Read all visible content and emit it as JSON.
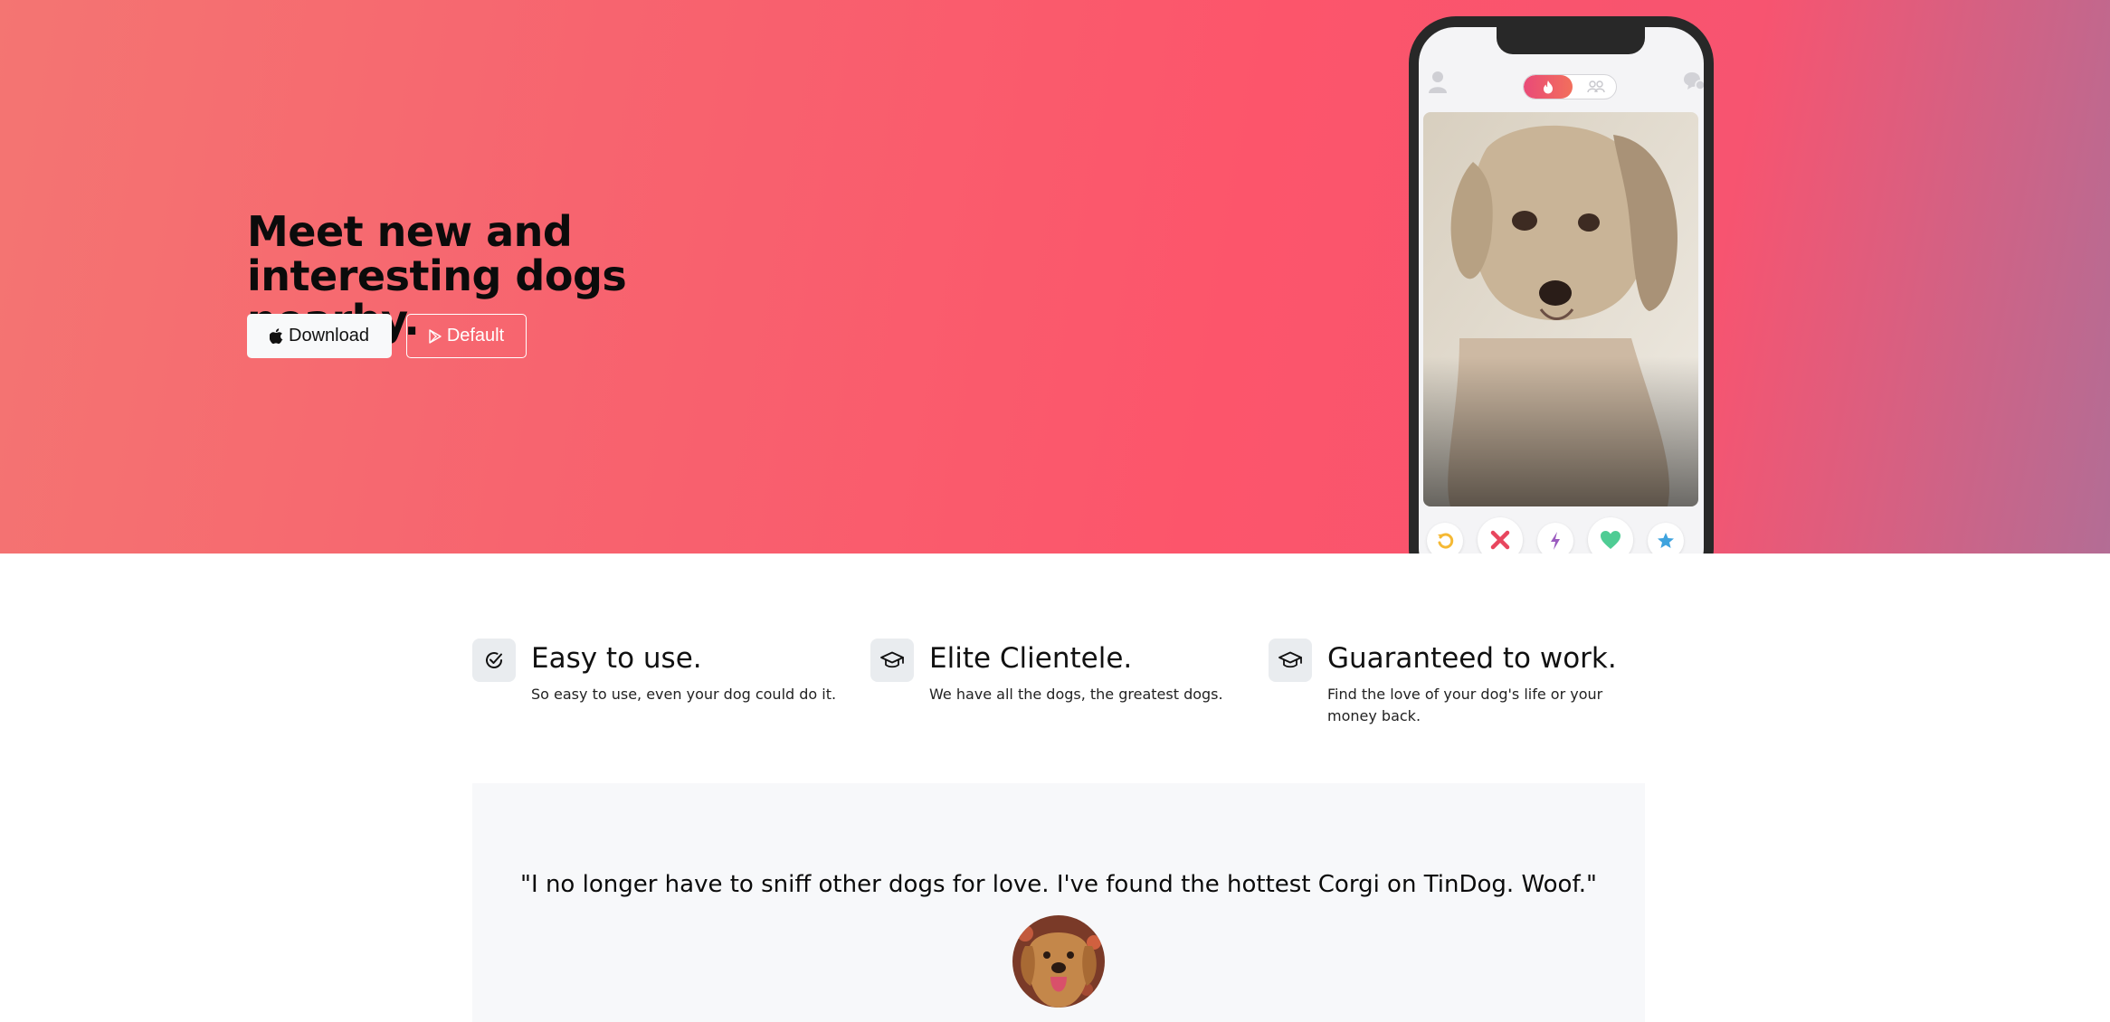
{
  "hero": {
    "title": "Meet new and interesting dogs nearby.",
    "download_label": "Download",
    "default_label": "Default",
    "gradient_colors": [
      "#f47572",
      "#fc556b",
      "#b36d95"
    ]
  },
  "phone": {
    "profile_icon": "person-icon",
    "chat_icon": "chat-bubbles-icon",
    "mode_toggle": {
      "active": "flame-icon",
      "inactive": "group-icon"
    },
    "card_image": "photo of small wet terrier dog",
    "actions": [
      {
        "name": "rewind-button",
        "icon": "rewind-icon",
        "color": "#f5b934"
      },
      {
        "name": "nope-button",
        "icon": "x-icon",
        "color": "#e8465e"
      },
      {
        "name": "boost-button",
        "icon": "bolt-icon",
        "color": "#9b5bbf"
      },
      {
        "name": "like-button",
        "icon": "heart-icon",
        "color": "#4fcc94"
      },
      {
        "name": "super-like-button",
        "icon": "star-icon",
        "color": "#3ea3de"
      }
    ]
  },
  "features": [
    {
      "icon": "check-circle-icon",
      "title": "Easy to use.",
      "text": "So easy to use, even your dog could do it."
    },
    {
      "icon": "graduation-cap-icon",
      "title": "Elite Clientele.",
      "text": "We have all the dogs, the greatest dogs."
    },
    {
      "icon": "graduation-cap-icon",
      "title": "Guaranteed to work.",
      "text": "Find the love of your dog's life or your money back."
    }
  ],
  "testimonial": {
    "quote": "\"I no longer have to sniff other dogs for love. I've found the hottest Corgi on TinDog. Woof.\"",
    "avatar_image": "golden retriever portrait"
  }
}
